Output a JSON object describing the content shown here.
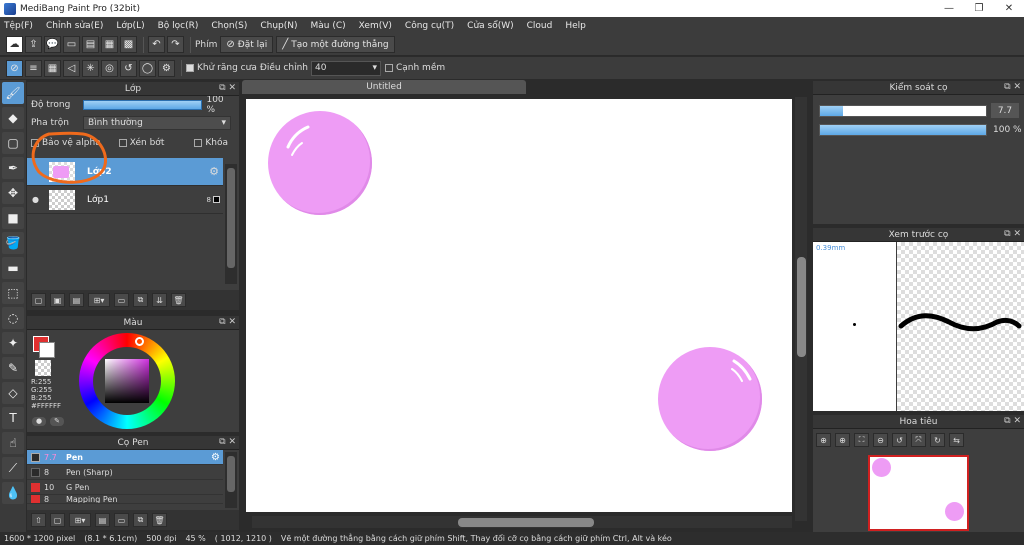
{
  "window": {
    "title": "MediBang Paint Pro (32bit)",
    "min": "—",
    "max": "❐",
    "close": "✕"
  },
  "menu": [
    "Tệp(F)",
    "Chỉnh sửa(E)",
    "Lớp(L)",
    "Bộ lọc(R)",
    "Chọn(S)",
    "Chụp(N)",
    "Màu (C)",
    "Xem(V)",
    "Công cụ(T)",
    "Cửa sổ(W)",
    "Cloud",
    "Help"
  ],
  "toolbar": {
    "phim_label": "Phím",
    "reset_label": "Đặt lại",
    "line_label": "Tạo một đường thẳng"
  },
  "toolbar2": {
    "antialias_label": "Khử răng cưa",
    "adjust_label": "Điều chỉnh",
    "adjust_value": "40",
    "edge_label": "Cạnh mềm"
  },
  "layer_panel": {
    "title": "Lớp",
    "opacity_label": "Độ trong",
    "opacity_value": "100 %",
    "opacity_fraction": 1.0,
    "blend_label": "Pha trộn",
    "blend_value": "Bình thường",
    "protect_alpha": "Bảo vệ alpha",
    "clip": "Xén bớt",
    "lock": "Khóa",
    "layers": [
      {
        "name": "Lớp2",
        "selected": true
      },
      {
        "name": "Lớp1",
        "selected": false,
        "badge": "8"
      }
    ]
  },
  "color_panel": {
    "title": "Màu",
    "r": "R:255",
    "g": "G:255",
    "b": "B:255",
    "hex": "#FFFFFF"
  },
  "brush_panel": {
    "title": "Cọ Pen",
    "brushes": [
      {
        "size": "7.7",
        "name": "Pen",
        "color": "#2b2b2b",
        "selected": true
      },
      {
        "size": "8",
        "name": "Pen (Sharp)",
        "color": "#2b2b2b",
        "selected": false
      },
      {
        "size": "10",
        "name": "G Pen",
        "color": "#e03030",
        "selected": false
      },
      {
        "size": "8",
        "name": "Mapping Pen",
        "color": "#e03030",
        "selected": false
      }
    ]
  },
  "canvas": {
    "tab": "Untitled"
  },
  "brush_control": {
    "title": "Kiểm soát cọ",
    "size_value": "7.7",
    "size_fraction": 0.14,
    "opacity_value": "100 %",
    "opacity_fraction": 1.0
  },
  "brush_preview": {
    "title": "Xem trước cọ",
    "size": "0.39mm"
  },
  "navigator": {
    "title": "Hoa tiêu"
  },
  "status": {
    "size": "1600 * 1200 pixel",
    "cm": "(8.1 * 6.1cm)",
    "dpi": "500 dpi",
    "zoom": "45 %",
    "coords": "( 1012, 1210 )",
    "hint": "Vẽ một đường thẳng bằng cách giữ phím Shift, Thay đổi cỡ cọ bằng cách giữ phím Ctrl, Alt và kéo"
  },
  "colors": {
    "accent": "#5b9bd5",
    "bubble": "#ee9cf5",
    "annotation": "#ef6a1c"
  }
}
